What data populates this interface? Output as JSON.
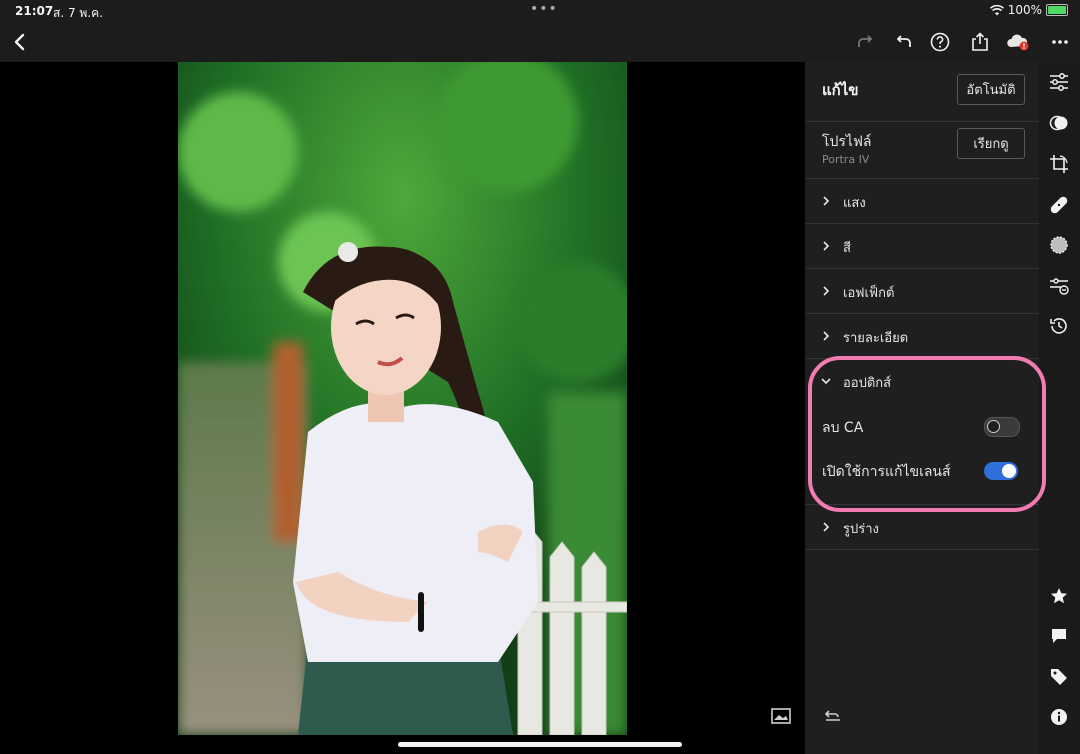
{
  "status": {
    "time": "21:07",
    "date": "ส. 7 พ.ค.",
    "battery": "100%"
  },
  "panel": {
    "edit_title": "แก้ไข",
    "auto_button": "อัตโนมัติ",
    "profile_title": "โปรไฟล์",
    "profile_value": "Portra IV",
    "browse_button": "เรียกดู",
    "sections": [
      {
        "label": "แสง",
        "expanded": false
      },
      {
        "label": "สี",
        "expanded": false
      },
      {
        "label": "เอฟเฟ็กต์",
        "expanded": false
      },
      {
        "label": "รายละเอียด",
        "expanded": false
      },
      {
        "label": "ออปติกส์",
        "expanded": true
      },
      {
        "label": "รูปร่าง",
        "expanded": false
      }
    ],
    "optics": {
      "remove_ca_label": "ลบ CA",
      "remove_ca_on": false,
      "lens_correction_label": "เปิดใช้การแก้ไขเลนส์",
      "lens_correction_on": true
    }
  },
  "colors": {
    "accent": "#2f6fdb",
    "highlight": "#f07cb2",
    "panel_bg": "#1f1f1f"
  },
  "icons": {
    "toolbar": [
      "back-icon",
      "redo-icon",
      "undo-icon",
      "help-icon",
      "share-icon",
      "cloud-icon",
      "more-icon"
    ],
    "rail": [
      "edit-sliders-icon",
      "presets-icon",
      "crop-icon",
      "healing-icon",
      "masking-icon",
      "versions-icon",
      "history-icon",
      "star-icon",
      "comment-icon",
      "tag-icon",
      "info-icon"
    ]
  }
}
